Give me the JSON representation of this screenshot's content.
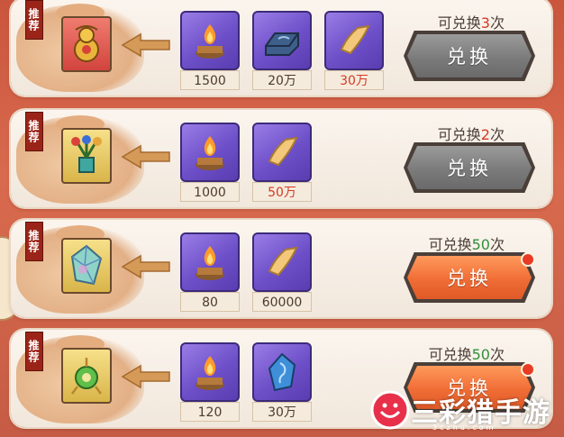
{
  "badge": "推荐",
  "exchange_button": "兑换",
  "count_prefix": "可兑换",
  "count_suffix": "次",
  "rows": [
    {
      "item_icon": "golden-gourd-icon",
      "count_value": "3",
      "count_color": "#d33a26",
      "button_state": "disabled",
      "has_notice_dot": false,
      "materials": [
        {
          "icon": "candle-icon",
          "amount": "1500",
          "amount_color": "#4a3a30"
        },
        {
          "icon": "iron-ingot-icon",
          "amount": "20万",
          "amount_color": "#4a3a30"
        },
        {
          "icon": "scroll-paper-icon",
          "amount": "30万",
          "amount_color": "#d33a26"
        }
      ]
    },
    {
      "item_icon": "flower-vase-icon",
      "count_value": "2",
      "count_color": "#d33a26",
      "button_state": "disabled",
      "has_notice_dot": false,
      "materials": [
        {
          "icon": "candle-icon",
          "amount": "1000",
          "amount_color": "#4a3a30"
        },
        {
          "icon": "scroll-paper-icon",
          "amount": "50万",
          "amount_color": "#d33a26"
        }
      ]
    },
    {
      "item_icon": "crystal-shard-icon",
      "count_value": "50",
      "count_color": "#2f8f3a",
      "button_state": "active",
      "has_notice_dot": true,
      "materials": [
        {
          "icon": "candle-icon",
          "amount": "80",
          "amount_color": "#4a3a30"
        },
        {
          "icon": "scroll-paper-icon",
          "amount": "60000",
          "amount_color": "#4a3a30"
        }
      ]
    },
    {
      "item_icon": "jade-pendant-icon",
      "count_value": "50",
      "count_color": "#2f8f3a",
      "button_state": "active",
      "has_notice_dot": true,
      "materials": [
        {
          "icon": "candle-icon",
          "amount": "120",
          "amount_color": "#4a3a30"
        },
        {
          "icon": "blue-gem-icon",
          "amount": "30万",
          "amount_color": "#4a3a30"
        }
      ]
    }
  ],
  "watermark": {
    "text": "三彩猎手游",
    "sub": "3czhu.com"
  }
}
